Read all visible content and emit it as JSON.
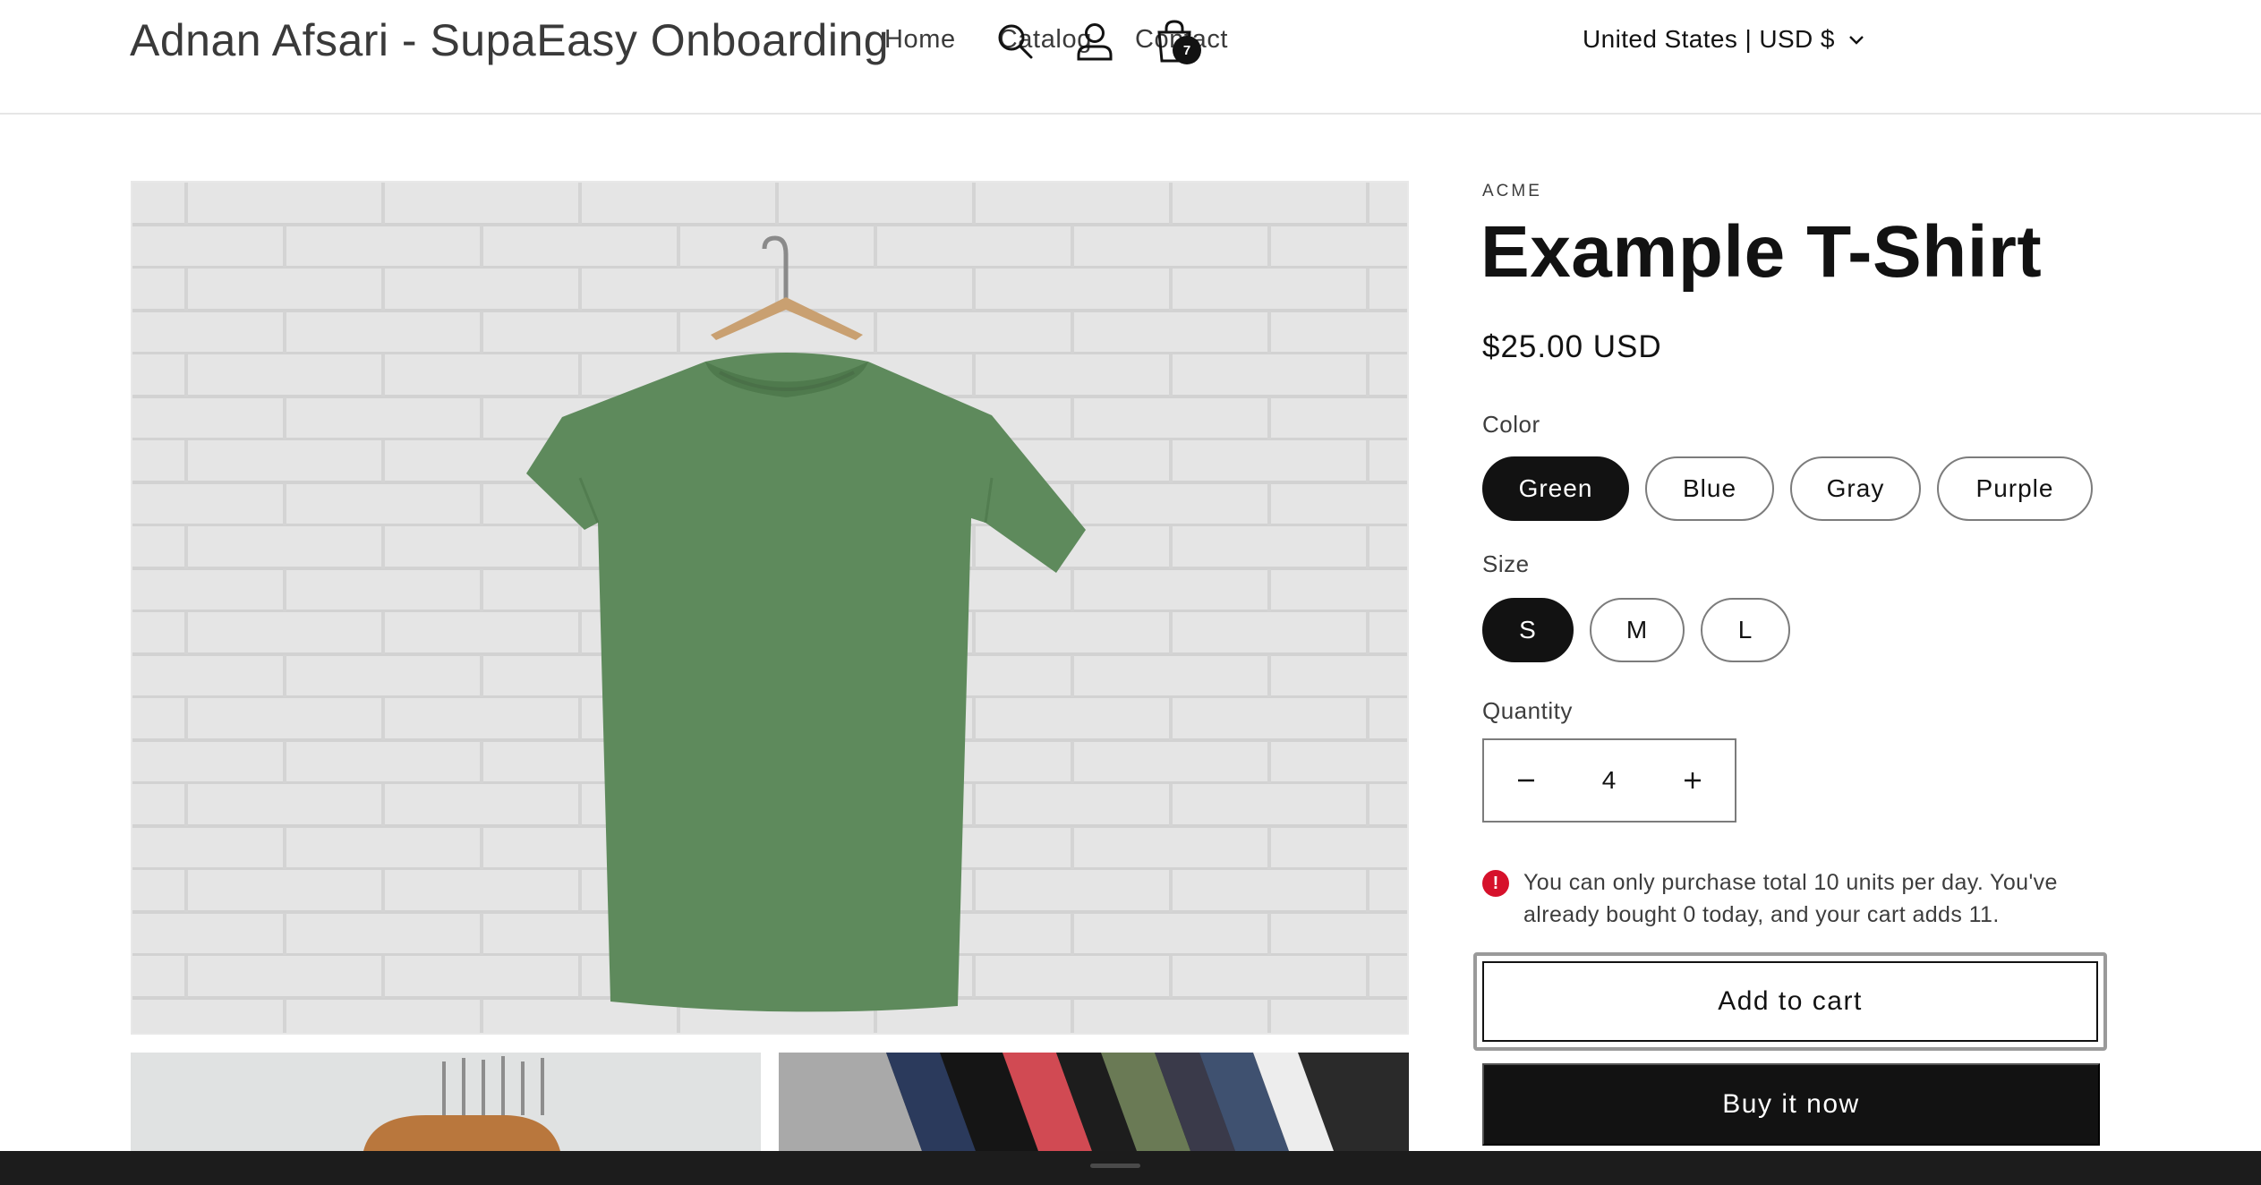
{
  "header": {
    "brand": "Adnan Afsari - SupaEasy Onboarding",
    "nav": [
      "Home",
      "Catalog",
      "Contact"
    ],
    "locale": "United States | USD $",
    "cart_count": "7",
    "icons": [
      "chevron-down-icon",
      "search-icon",
      "account-icon",
      "cart-icon"
    ]
  },
  "product": {
    "vendor": "ACME",
    "title": "Example T-Shirt",
    "price": "$25.00 USD",
    "color_label": "Color",
    "colors": [
      "Green",
      "Blue",
      "Gray",
      "Purple"
    ],
    "selected_color": "Green",
    "size_label": "Size",
    "sizes": [
      "S",
      "M",
      "L"
    ],
    "selected_size": "S",
    "quantity_label": "Quantity",
    "quantity": "4",
    "error_message": "You can only purchase total 10 units per day. You've already bought 0 today, and your cart adds 11.",
    "add_to_cart": "Add to cart",
    "buy_now": "Buy it now"
  },
  "colors": {
    "primary": "#121212",
    "error": "#d6112b",
    "shirt_green": "#5e8a5c",
    "wall": "#e4e4e4"
  }
}
